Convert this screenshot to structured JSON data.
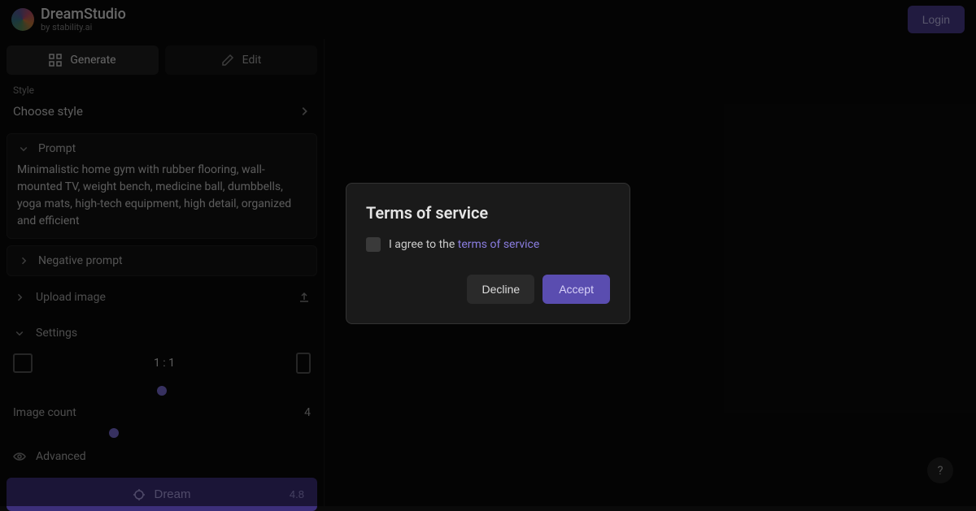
{
  "header": {
    "brand_title": "DreamStudio",
    "brand_by": "by ",
    "brand_company": "stability.ai",
    "login_label": "Login"
  },
  "tabs": {
    "generate": "Generate",
    "edit": "Edit"
  },
  "style": {
    "label": "Style",
    "value": "Choose style"
  },
  "prompt": {
    "label": "Prompt",
    "text": "Minimalistic home gym with rubber flooring, wall-mounted TV, weight bench, medicine ball, dumbbells, yoga mats, high-tech equipment, high detail, organized and efficient"
  },
  "negative": {
    "label": "Negative prompt"
  },
  "upload": {
    "label": "Upload image"
  },
  "settings": {
    "label": "Settings",
    "ratio": "1 : 1",
    "image_count_label": "Image count",
    "image_count_value": "4",
    "advanced": "Advanced"
  },
  "dream": {
    "label": "Dream",
    "cost": "4.8"
  },
  "modal": {
    "title": "Terms of service",
    "agree_prefix": "I agree to the ",
    "tos_link": "terms of service",
    "decline": "Decline",
    "accept": "Accept"
  },
  "help": "?"
}
